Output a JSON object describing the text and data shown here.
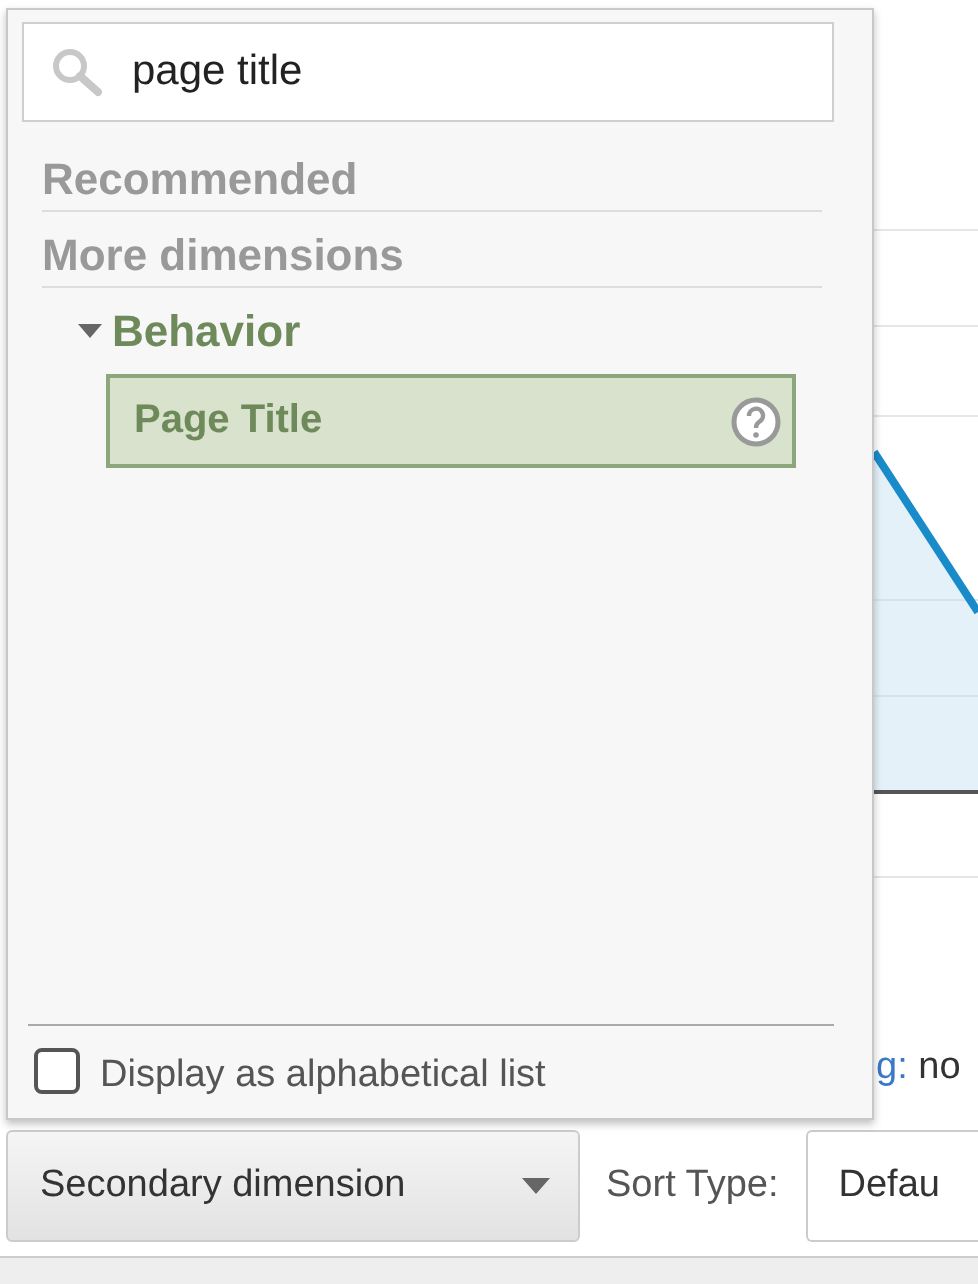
{
  "search": {
    "value": "page title"
  },
  "sections": [
    {
      "label": "Recommended"
    },
    {
      "label": "More dimensions"
    }
  ],
  "groups": [
    {
      "label": "Behavior",
      "expanded": true,
      "children": [
        {
          "label": "Page Title",
          "selected": true
        }
      ]
    }
  ],
  "alphabetical": {
    "label": "Display as alphabetical list",
    "checked": false
  },
  "background": {
    "link_fragment": "g:",
    "text_fragment": "no"
  },
  "toolbar": {
    "secondary_dimension": "Secondary dimension",
    "sort_label": "Sort Type:",
    "sort_value": "Defau"
  }
}
